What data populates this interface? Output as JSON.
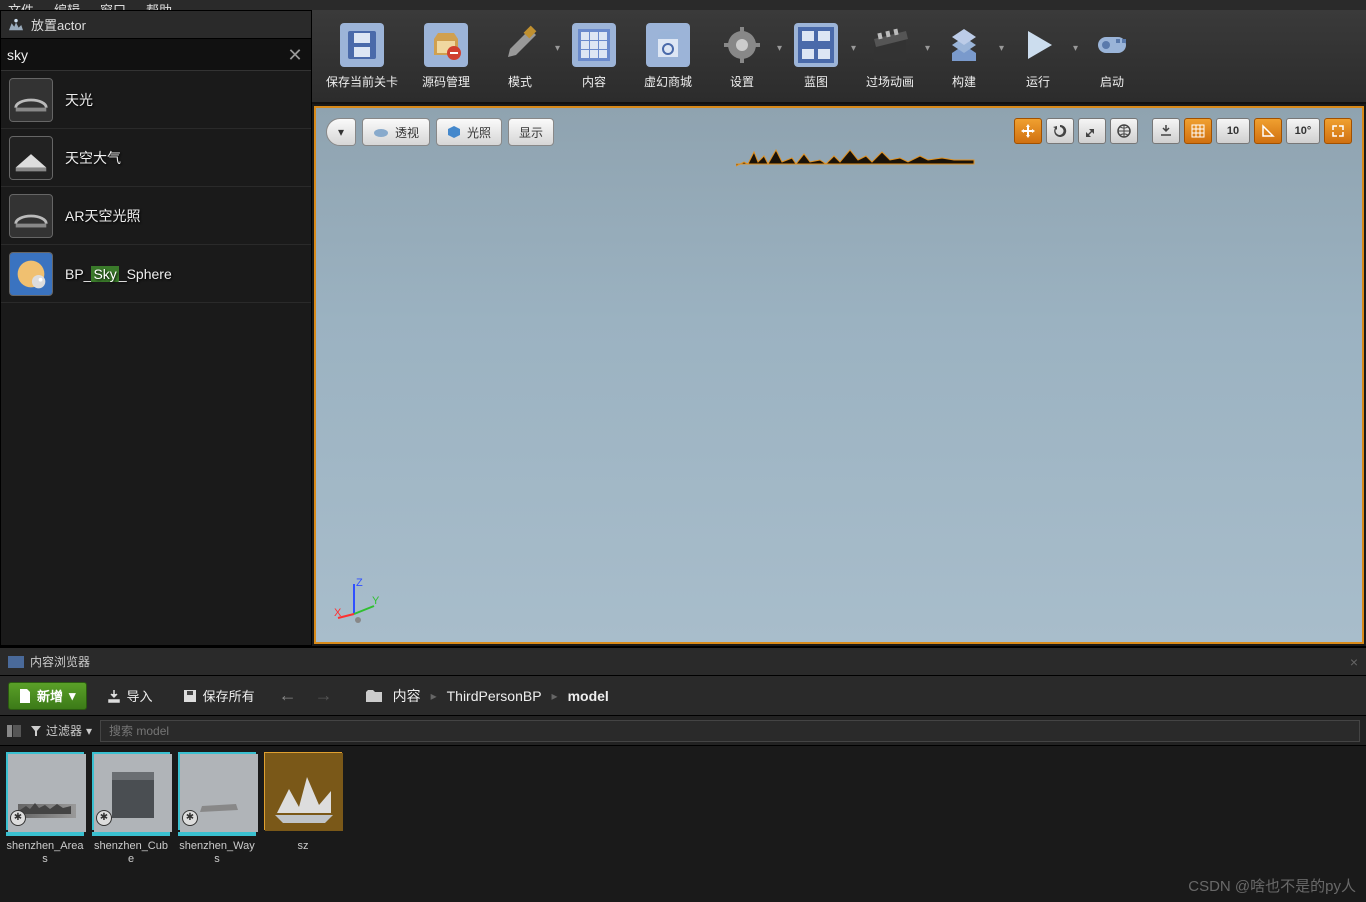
{
  "menubar": {
    "file": "文件",
    "edit": "编辑",
    "window": "窗口",
    "help": "帮助"
  },
  "place_actors": {
    "title": "放置actor",
    "search_value": "sky",
    "items": [
      {
        "label": "天光"
      },
      {
        "label": "天空大气"
      },
      {
        "label": "AR天空光照"
      },
      {
        "prefix": "BP_",
        "hl": "Sky",
        "suffix": "_Sphere"
      }
    ]
  },
  "toolbar": {
    "save": "保存当前关卡",
    "source": "源码管理",
    "mode": "模式",
    "content": "内容",
    "marketplace": "虚幻商城",
    "settings": "设置",
    "blueprints": "蓝图",
    "cinematics": "过场动画",
    "build": "构建",
    "play": "运行",
    "launch": "启动"
  },
  "viewport": {
    "perspective": "透视",
    "lighting": "光照",
    "show": "显示",
    "snap_pos": "10",
    "snap_rot": "10°"
  },
  "content_browser": {
    "title": "内容浏览器",
    "add_new": "新增",
    "import": "导入",
    "save_all": "保存所有",
    "breadcrumb": [
      "内容",
      "ThirdPersonBP",
      "model"
    ],
    "filters": "过滤器",
    "search_placeholder": "搜索 model",
    "assets": [
      {
        "label": "shenzhen_Areas"
      },
      {
        "label": "shenzhen_Cube"
      },
      {
        "label": "shenzhen_Ways"
      },
      {
        "label": "sz"
      }
    ]
  },
  "watermark": "CSDN @啥也不是的py人"
}
